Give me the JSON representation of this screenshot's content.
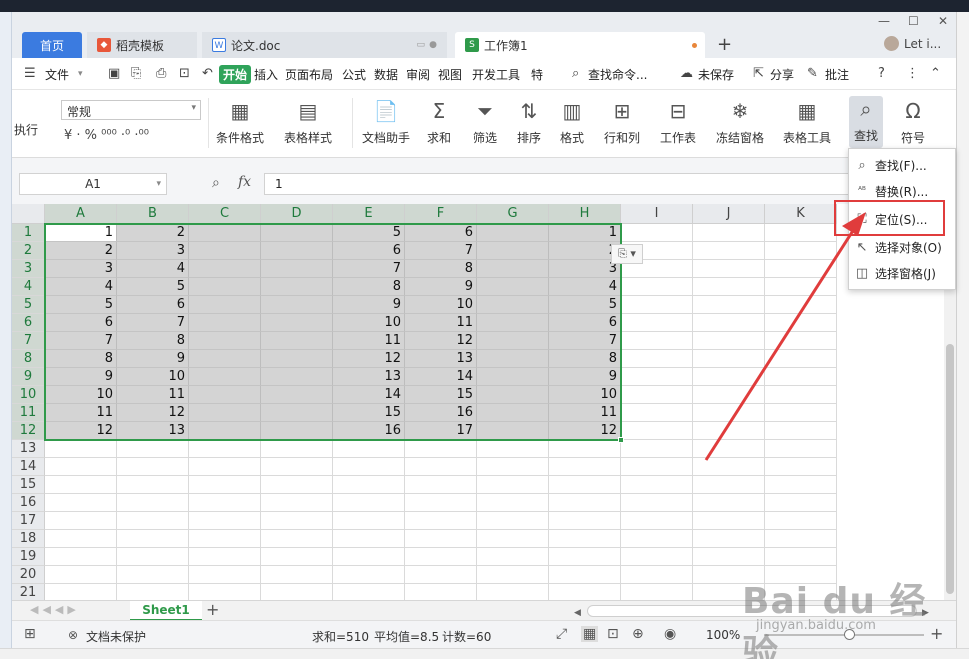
{
  "tabs": {
    "home": "首页",
    "t2": "稻壳模板",
    "t3": "论文.doc",
    "t4": "工作簿1",
    "user": "Let i..."
  },
  "menu": {
    "file": "文件",
    "items": [
      "开始",
      "插入",
      "页面布局",
      "公式",
      "数据",
      "审阅",
      "视图",
      "开发工具",
      "特"
    ],
    "search": "查找命令...",
    "unsaved": "未保存",
    "share": "分享",
    "annotate": "批注"
  },
  "ribbon": {
    "number_format": "常规",
    "exec": "执行",
    "format_symbols": "¥ · % ⁰⁰⁰ ·⁰ ·⁰⁰",
    "buttons": [
      "条件格式",
      "表格样式",
      "文档助手",
      "求和",
      "筛选",
      "排序",
      "格式",
      "行和列",
      "工作表",
      "冻结窗格",
      "表格工具",
      "查找",
      "符号"
    ]
  },
  "formula_bar": {
    "name_box": "A1",
    "fx": "fx",
    "content": "1"
  },
  "grid": {
    "columns": [
      "A",
      "B",
      "C",
      "D",
      "E",
      "F",
      "G",
      "H",
      "I",
      "J",
      "K"
    ],
    "rows": [
      "1",
      "2",
      "3",
      "4",
      "5",
      "6",
      "7",
      "8",
      "9",
      "10",
      "11",
      "12",
      "13",
      "14",
      "15",
      "16",
      "17",
      "18",
      "19",
      "20",
      "21"
    ],
    "data": [
      [
        "1",
        "2",
        "",
        "",
        "5",
        "6",
        "",
        "1"
      ],
      [
        "2",
        "3",
        "",
        "",
        "6",
        "7",
        "",
        "2"
      ],
      [
        "3",
        "4",
        "",
        "",
        "7",
        "8",
        "",
        "3"
      ],
      [
        "4",
        "5",
        "",
        "",
        "8",
        "9",
        "",
        "4"
      ],
      [
        "5",
        "6",
        "",
        "",
        "9",
        "10",
        "",
        "5"
      ],
      [
        "6",
        "7",
        "",
        "",
        "10",
        "11",
        "",
        "6"
      ],
      [
        "7",
        "8",
        "",
        "",
        "11",
        "12",
        "",
        "7"
      ],
      [
        "8",
        "9",
        "",
        "",
        "12",
        "13",
        "",
        "8"
      ],
      [
        "9",
        "10",
        "",
        "",
        "13",
        "14",
        "",
        "9"
      ],
      [
        "10",
        "11",
        "",
        "",
        "14",
        "15",
        "",
        "10"
      ],
      [
        "11",
        "12",
        "",
        "",
        "15",
        "16",
        "",
        "11"
      ],
      [
        "12",
        "13",
        "",
        "",
        "16",
        "17",
        "",
        "12"
      ]
    ]
  },
  "sheet": {
    "name": "Sheet1"
  },
  "status": {
    "protect": "文档未保护",
    "sum": "求和=510",
    "avg": "平均值=8.5",
    "count": "计数=60",
    "zoom": "100%"
  },
  "find_menu": {
    "items": [
      {
        "label": "查找(F)...",
        "icon": "search-icon"
      },
      {
        "label": "替换(R)...",
        "icon": "replace-icon"
      },
      {
        "label": "定位(S)...",
        "icon": "goto-icon"
      },
      {
        "label": "选择对象(O)",
        "icon": "pointer-icon"
      },
      {
        "label": "选择窗格(J)",
        "icon": "pane-icon"
      }
    ],
    "highlight_color": "#e03c3c"
  },
  "watermark": {
    "text": "Bai du 经验",
    "url": "jingyan.baidu.com"
  },
  "colors": {
    "accent_green": "#2f9a4a",
    "tab_blue": "#3b7be0",
    "arrow_red": "#e03c3c"
  }
}
